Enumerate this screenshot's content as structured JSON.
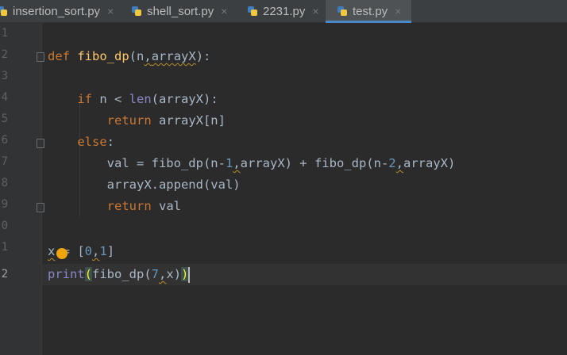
{
  "tabs": [
    {
      "name": "insertion_sort.py",
      "close": "×"
    },
    {
      "name": "shell_sort.py",
      "close": "×"
    },
    {
      "name": "2231.py",
      "close": "×"
    },
    {
      "name": "test.py",
      "close": "×",
      "active": true
    }
  ],
  "gutter": {
    "line_numbers": [
      "1",
      "2",
      "3",
      "4",
      "5",
      "6",
      "7",
      "8",
      "9",
      "0",
      "1",
      "2"
    ]
  },
  "code": {
    "l2": {
      "def": "def",
      "fn": "fibo_dp",
      "open": "(",
      "p1": "n",
      "comma": ",",
      "p2": "arrayX",
      "close": "):"
    },
    "l4": {
      "if": "if",
      "mid": " n < ",
      "len": "len",
      "rest": "(arrayX):"
    },
    "l5": {
      "ret": "return",
      "rest": " arrayX[n]"
    },
    "l6": {
      "else": "else",
      "colon": ":"
    },
    "l7": {
      "a": "val = fibo_dp(n-",
      "n1": "1",
      "c1": ",",
      "b": "arrayX) + fibo_dp(n-",
      "n2": "2",
      "c2": ",",
      "c": "arrayX)"
    },
    "l8": {
      "text": "arrayX.append(val)"
    },
    "l9": {
      "ret": "return",
      "rest": " val"
    },
    "l11": {
      "x": "x",
      "eq": " = [",
      "n0": "0",
      "c": ",",
      "n1": "1",
      "close": "]"
    },
    "l12": {
      "print": "print",
      "open": "(",
      "a": "fibo_dp(",
      "n7": "7",
      "c": ",",
      "x": "x)",
      "close": ")"
    }
  },
  "colors": {
    "accent": "#4a88c7",
    "keyword": "#cc7832",
    "function": "#ffc66d",
    "number": "#6897bb",
    "builtin": "#8888c6"
  }
}
